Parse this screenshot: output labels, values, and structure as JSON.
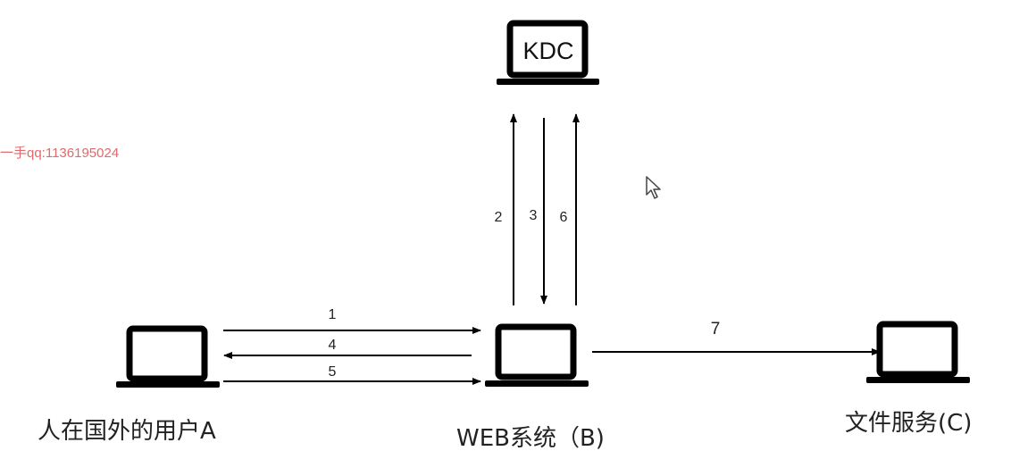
{
  "watermark": "一手qq:1136195024",
  "nodes": {
    "kdc": {
      "label": "KDC"
    },
    "user": {
      "label": "人在国外的用户A"
    },
    "web": {
      "label": "WEB系统（B)"
    },
    "file": {
      "label": "文件服务(C)"
    }
  },
  "edges": [
    {
      "step": "1",
      "from": "user",
      "to": "web"
    },
    {
      "step": "4",
      "from": "web",
      "to": "user"
    },
    {
      "step": "5",
      "from": "user",
      "to": "web"
    },
    {
      "step": "2",
      "from": "web",
      "to": "kdc"
    },
    {
      "step": "3",
      "from": "kdc",
      "to": "web"
    },
    {
      "step": "6",
      "from": "web",
      "to": "kdc"
    },
    {
      "step": "7",
      "from": "web",
      "to": "file"
    }
  ],
  "colors": {
    "stroke": "#000000",
    "text": "#222222",
    "watermark": "#e06a6a"
  },
  "icons": {
    "node": "laptop-icon",
    "pointer": "mouse-cursor-icon"
  }
}
